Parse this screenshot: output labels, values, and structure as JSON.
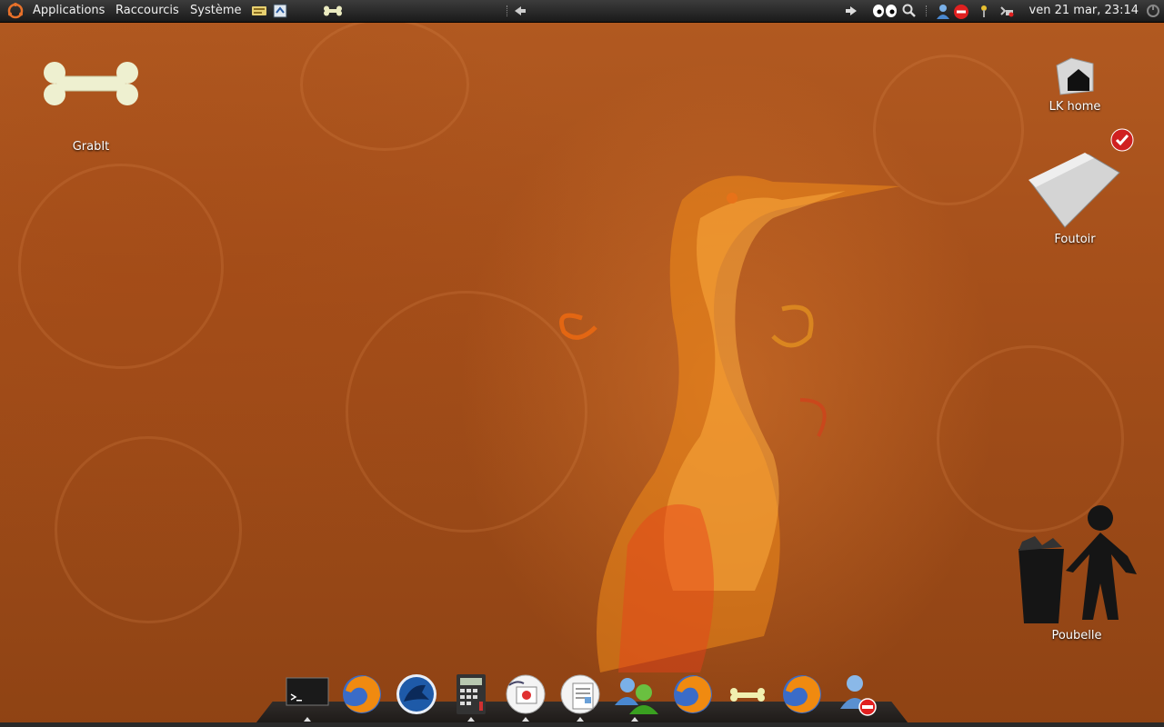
{
  "top_panel": {
    "menus": {
      "applications": "Applications",
      "shortcuts": "Raccourcis",
      "system": "Système"
    },
    "launchers": [
      "text-editor-icon",
      "screenshot-icon",
      "grabit-bone-icon"
    ],
    "tray": [
      "network-arrow-icon",
      "eyes-icon",
      "search-icon",
      "user-icon",
      "stop-icon",
      "pin-icon",
      "battery-icon"
    ],
    "clock": "ven 21 mar, 23:14"
  },
  "desktop": {
    "icons": [
      {
        "label": "GrabIt",
        "icon": "bone-icon"
      },
      {
        "label": "LK home",
        "icon": "home-folder-icon"
      },
      {
        "label": "Foutoir",
        "icon": "folder-icon"
      },
      {
        "label": "Poubelle",
        "icon": "trash-icon"
      }
    ]
  },
  "dock": {
    "items": [
      "terminal-icon",
      "firefox-icon",
      "browser-icon",
      "calculator-icon",
      "presentation-icon",
      "document-icon",
      "messenger-icon",
      "firefox-icon",
      "bone-icon",
      "firefox-icon",
      "user-block-icon"
    ]
  },
  "colors": {
    "background": "#a54f1a",
    "panel": "#1a1a1a",
    "accent": "#e8a040"
  }
}
